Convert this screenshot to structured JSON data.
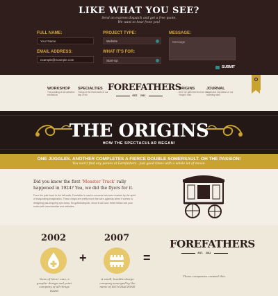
{
  "contact": {
    "title": "LIKE WHAT YOU SEE?",
    "subtitle_1": "Send an express dispatch and get a free quote.",
    "subtitle_2": "We want to hear from you!",
    "full_name_label": "FULL NAME:",
    "full_name_placeholder": "Your Name",
    "email_label": "EMAIL ADDRESS:",
    "email_placeholder": "example@example.com",
    "project_type_label": "PROJECT TYPE:",
    "project_type_value": "Website",
    "what_for_label": "WHAT IT'S FOR:",
    "what_for_value": "Start-Up",
    "message_label": "MESSAGE:",
    "message_placeholder": "Message",
    "submit_label": "SUBMIT"
  },
  "nav": {
    "items": [
      {
        "title": "WORKSHOP",
        "desc": "The pudding of all collective exhibitions"
      },
      {
        "title": "SPECIALTIES",
        "desc": "Things of the finest sorts in our day of fun"
      },
      {
        "title": "ORIGINS",
        "desc": "Here we gathered the lore of a Yonge's man"
      },
      {
        "title": "JOURNAL",
        "desc": "A genuine exposition of our traveling tales"
      }
    ],
    "logo": {
      "word": "FOREFATHERS",
      "est": "EST.",
      "year": "2011"
    }
  },
  "hero": {
    "title": "THE ORIGINS",
    "subtitle": "HOW THE SPECTACULAR BEGAN!"
  },
  "band": {
    "title": "ONE JUGGLES. ANOTHER COMPLETES A FIERCE DOUBLE SOMERSAULT. OH THE PASSION!",
    "sub": "You won't find any ponies at Forefathers - just good times with a whole lot of moxie."
  },
  "story": {
    "lead_before": "Did you know the first ",
    "lead_highlight": "'Monster Truck'",
    "lead_after": " rally happened in 1924? Yea, we did the flyers for it.",
    "body": "From the joke fount to the tall walls, Forefather's road to success has been marked by the spirit of invigorating imagination. These chaps are pretty much the cat's pyjamas when it comes to designing jaw-dropping eye-fancy. No gobbledegook, shout it out loud: these fellas rock your socks with merchandise and websites."
  },
  "timeline": {
    "year_left": "2002",
    "year_right": "2007",
    "plus": "+",
    "equals": "=",
    "cap_left": "'Sons of Nero' man, a graphic design and print company of all things HARD",
    "cap_right": "A small, humble design company emerged by the name of ROTOMACHINE",
    "cap_logo": "These companies created this.",
    "logo_word": "FOREFATHERS",
    "logo_est": "EST.",
    "logo_year": "2011"
  },
  "colors": {
    "dark": "#2f1e1c",
    "accent": "#c9a32f",
    "teal": "#2f8a8a",
    "red": "#c0392b"
  }
}
